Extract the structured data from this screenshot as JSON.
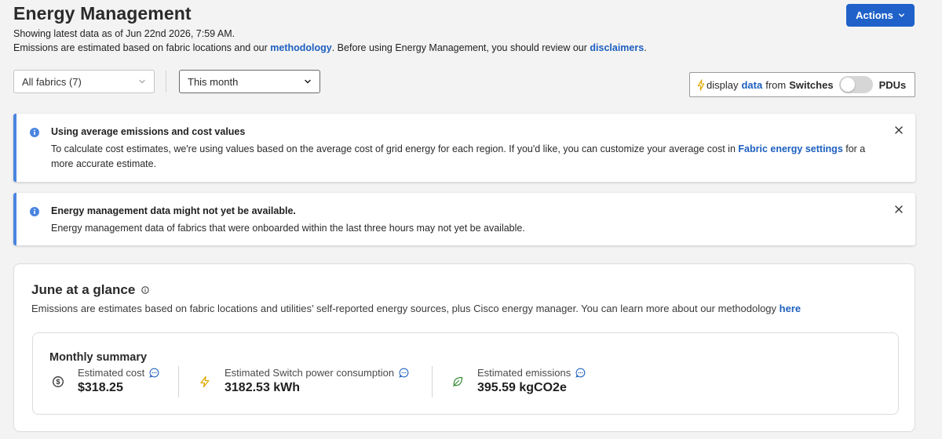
{
  "header": {
    "title": "Energy Management",
    "latest_data": "Showing latest data as of Jun 22nd 2026, 7:59 AM.",
    "emissions_prefix": "Emissions are estimated based on fabric locations and our ",
    "methodology_link": "methodology",
    "emissions_middle": ". Before using Energy Management, you should review our ",
    "disclaimers_link": "disclaimers",
    "emissions_suffix": ".",
    "actions_label": "Actions"
  },
  "filters": {
    "fabrics": "All fabrics (7)",
    "period": "This month"
  },
  "source_toggle": {
    "display": "display",
    "data": "data",
    "from": "from",
    "left_option": "Switches",
    "right_option": "PDUs",
    "on": false
  },
  "banners": [
    {
      "title": "Using average emissions and cost values",
      "text_prefix": "To calculate cost estimates, we're using values based on the average cost of grid energy for each region. If you'd like, you can customize your average cost in ",
      "link": "Fabric energy settings",
      "text_suffix": " for a more accurate estimate."
    },
    {
      "title": "Energy management data might not yet be available.",
      "text": "Energy management data of fabrics that were onboarded within the last three hours may not yet be available."
    }
  ],
  "glance": {
    "title": "June at a glance",
    "description": "Emissions are estimates based on fabric locations and utilities’ self-reported energy sources, plus Cisco energy manager. You can learn more about our methodology ",
    "here_link": "here",
    "summary": {
      "title": "Monthly summary",
      "metrics": [
        {
          "label": "Estimated cost",
          "value": "$318.25",
          "icon": "dollar-circle-icon"
        },
        {
          "label": "Estimated Switch power consumption",
          "value": "3182.53 kWh",
          "icon": "lightning-icon"
        },
        {
          "label": "Estimated emissions",
          "value": "395.59 kgCO2e",
          "icon": "leaf-icon"
        }
      ]
    }
  },
  "colors": {
    "accent": "#1f61c9",
    "link": "#1d5fbf",
    "banner_border": "#4a85e0",
    "lightning": "#e0a800",
    "leaf": "#3e8e3e"
  }
}
